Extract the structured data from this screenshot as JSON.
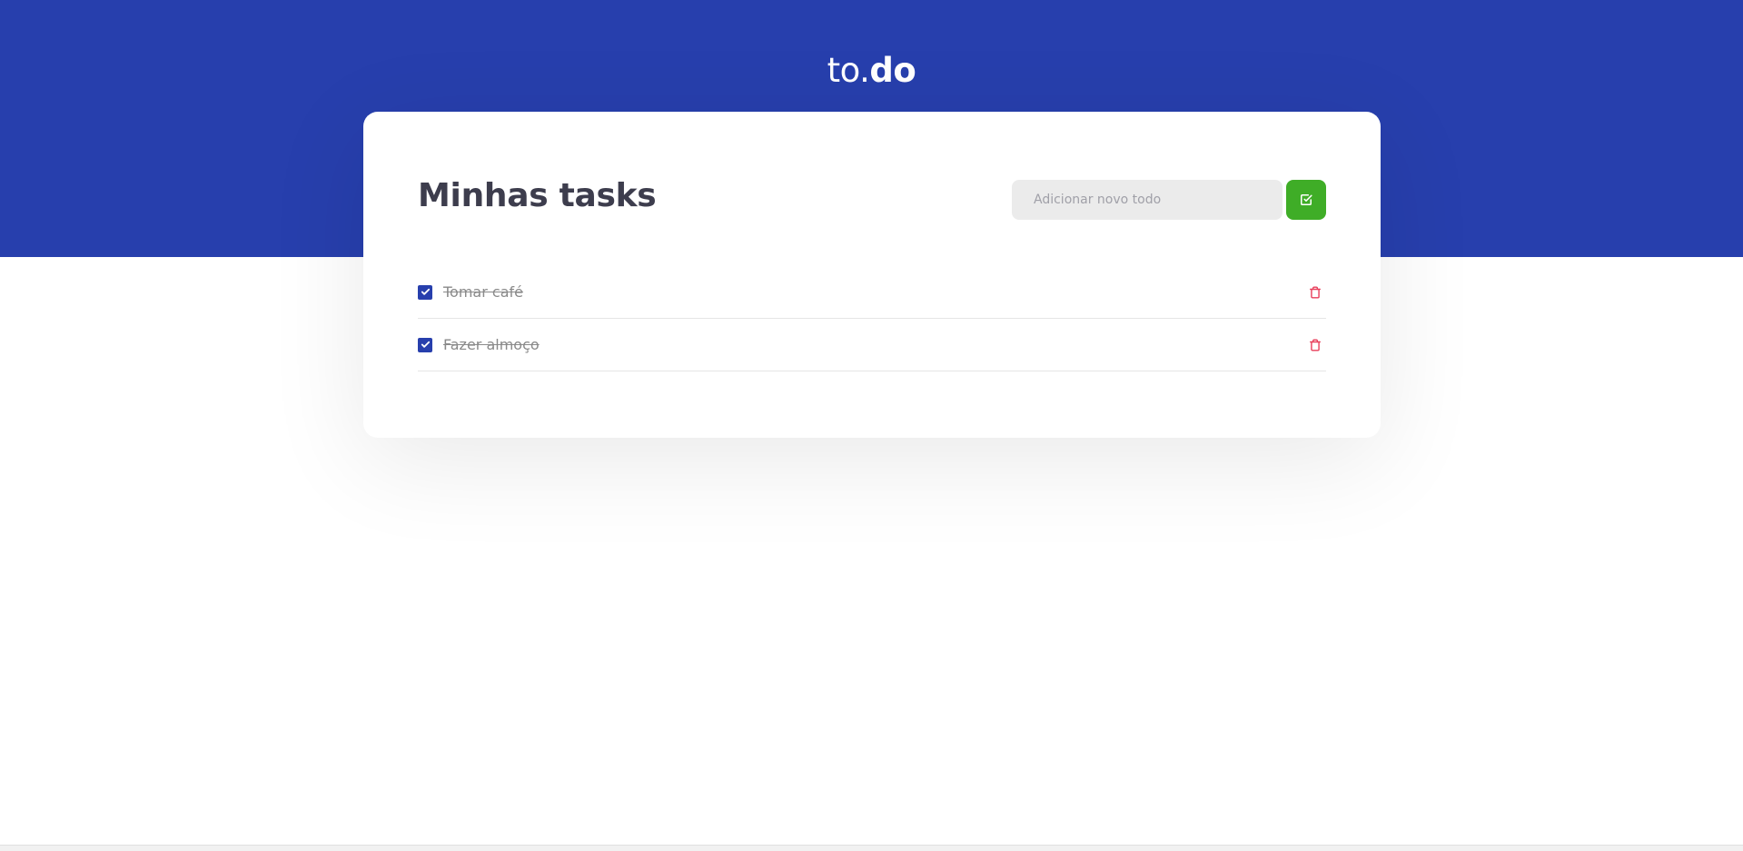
{
  "header": {
    "logo_prefix": "to.",
    "logo_suffix": "do",
    "background_color": "#273fad"
  },
  "card": {
    "title": "Minhas tasks",
    "input_placeholder": "Adicionar novo todo",
    "input_value": "",
    "add_button_icon": "check-square-icon",
    "add_button_color": "#3fad27"
  },
  "todos": [
    {
      "title": "Tomar café",
      "completed": true,
      "delete_icon": "trash-icon"
    },
    {
      "title": "Fazer almoço",
      "completed": true,
      "delete_icon": "trash-icon"
    }
  ],
  "colors": {
    "accent": "#273fad",
    "success": "#3fad27",
    "danger": "#e83f5b"
  }
}
